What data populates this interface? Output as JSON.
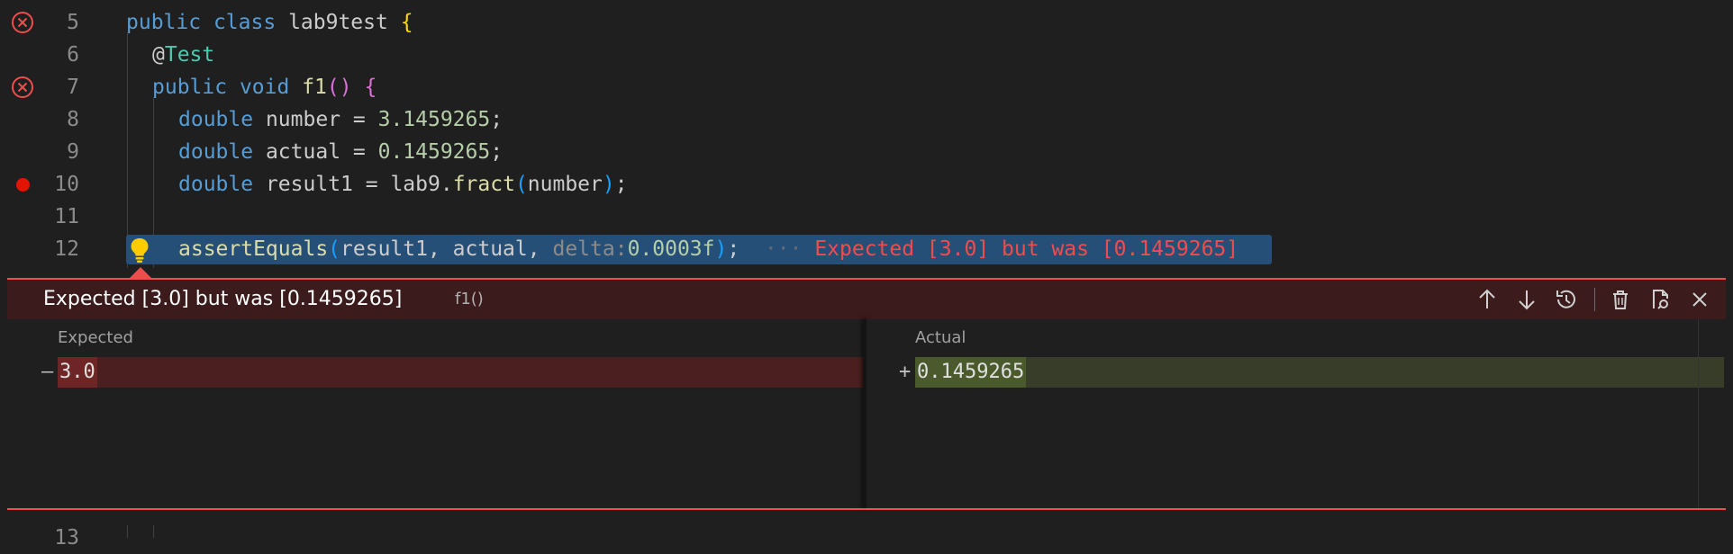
{
  "editor": {
    "lines": [
      {
        "num": "5",
        "text": "public class lab9test {",
        "status": "error"
      },
      {
        "num": "6",
        "text": "@Test",
        "status": ""
      },
      {
        "num": "7",
        "text": "public void f1() {",
        "status": "error"
      },
      {
        "num": "8",
        "text": "double number = 3.1459265;",
        "status": ""
      },
      {
        "num": "9",
        "text": "double actual = 0.1459265;",
        "status": ""
      },
      {
        "num": "10",
        "text": "double result1 = lab9.fract(number);",
        "status": "breakpoint"
      },
      {
        "num": "11",
        "text": "",
        "status": ""
      },
      {
        "num": "12",
        "text": "assertEquals(result1, actual, delta:0.0003f);",
        "status": "lightbulb"
      },
      {
        "num": "13",
        "text": "",
        "status": ""
      }
    ],
    "tokens": {
      "public": "public",
      "class": "class",
      "class_name": "lab9test",
      "annotation_at": "@",
      "annotation": "Test",
      "void": "void",
      "method": "f1",
      "double": "double",
      "var_number": "number",
      "val_number": "3.1459265",
      "var_actual": "actual",
      "val_actual": "0.1459265",
      "var_result": "result1",
      "call_obj": "lab9",
      "call_fn": "fract",
      "arg_number": "number",
      "assert_fn": "assertEquals",
      "arg_result": "result1",
      "arg_actual": "actual",
      "hint_label": "delta:",
      "hint_value": "0.0003f"
    },
    "inline_error": "Expected [3.0] but was [0.1459265]"
  },
  "peek": {
    "title": "Expected [3.0] but was [0.1459265]",
    "subtitle": "f1()",
    "actions": [
      "arrow-up-icon",
      "arrow-down-icon",
      "history-icon",
      "trash-icon",
      "open-file-icon",
      "close-icon"
    ],
    "expected_label": "Expected",
    "expected_marker": "—",
    "expected_value": "3.0",
    "actual_label": "Actual",
    "actual_marker": "+",
    "actual_value": "0.1459265"
  },
  "colors": {
    "error": "#f14c4c",
    "breakpoint": "#e51400",
    "selection": "#264f78",
    "removed_bg": "#4b1f1f",
    "added_bg": "#373d29"
  }
}
